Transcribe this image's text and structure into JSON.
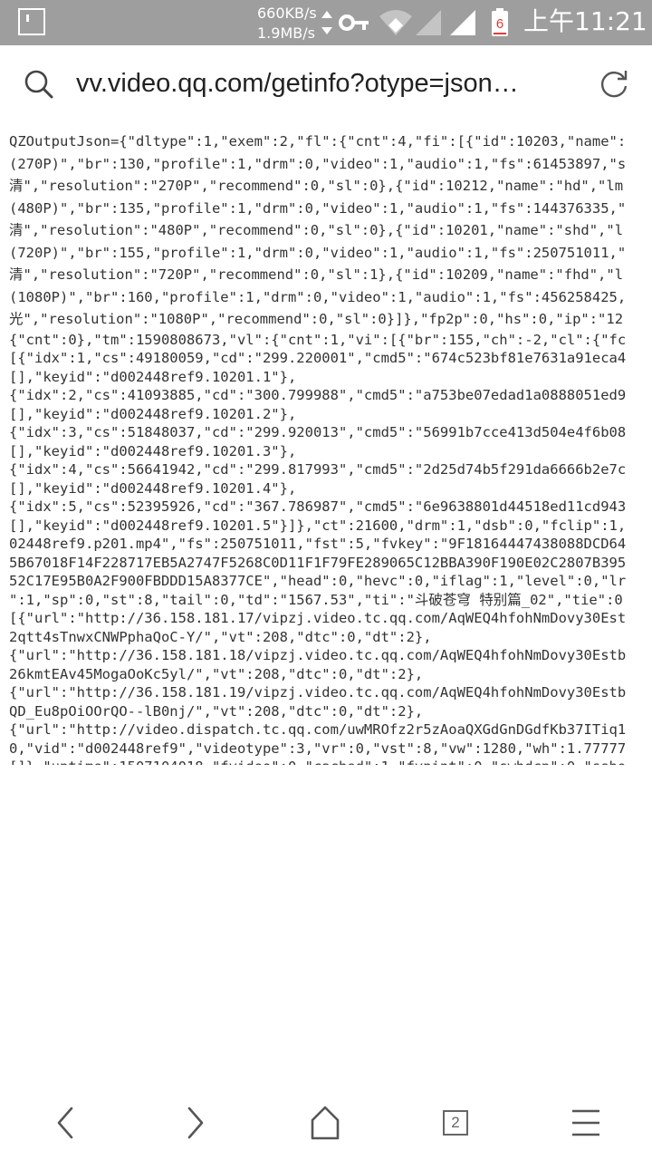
{
  "status_bar": {
    "speed_up": "660KB/s",
    "speed_down": "1.9MB/s",
    "battery_level": "6",
    "time": "上午11:21",
    "icons": [
      "notification-icon",
      "data-arrows-icon",
      "vpn-key-icon",
      "wifi-icon",
      "signal-icon",
      "signal-icon",
      "battery-icon"
    ]
  },
  "browser": {
    "url": "vv.video.qq.com/getinfo?otype=json…",
    "tab_count": "2"
  },
  "content": {
    "lines": [
      "QZOutputJson={\"dltype\":1,\"exem\":2,\"fl\":{\"cnt\":4,\"fi\":[{\"id\":10203,\"name\":",
      "(270P)\",\"br\":130,\"profile\":1,\"drm\":0,\"video\":1,\"audio\":1,\"fs\":61453897,\"s",
      "清\",\"resolution\":\"270P\",\"recommend\":0,\"sl\":0},{\"id\":10212,\"name\":\"hd\",\"lm",
      "(480P)\",\"br\":135,\"profile\":1,\"drm\":0,\"video\":1,\"audio\":1,\"fs\":144376335,\"",
      "清\",\"resolution\":\"480P\",\"recommend\":0,\"sl\":0},{\"id\":10201,\"name\":\"shd\",\"l",
      "(720P)\",\"br\":155,\"profile\":1,\"drm\":0,\"video\":1,\"audio\":1,\"fs\":250751011,\"",
      "清\",\"resolution\":\"720P\",\"recommend\":0,\"sl\":1},{\"id\":10209,\"name\":\"fhd\",\"l",
      "(1080P)\",\"br\":160,\"profile\":1,\"drm\":0,\"video\":1,\"audio\":1,\"fs\":456258425,",
      "光\",\"resolution\":\"1080P\",\"recommend\":0,\"sl\":0}]},\"fp2p\":0,\"hs\":0,\"ip\":\"12",
      "{\"cnt\":0},\"tm\":1590808673,\"vl\":{\"cnt\":1,\"vi\":[{\"br\":155,\"ch\":-2,\"cl\":{\"fc",
      "[{\"idx\":1,\"cs\":49180059,\"cd\":\"299.220001\",\"cmd5\":\"674c523bf81e7631a91eca4",
      "[],\"keyid\":\"d002448ref9.10201.1\"},",
      "{\"idx\":2,\"cs\":41093885,\"cd\":\"300.799988\",\"cmd5\":\"a753be07edad1a0888051ed9",
      "[],\"keyid\":\"d002448ref9.10201.2\"},",
      "{\"idx\":3,\"cs\":51848037,\"cd\":\"299.920013\",\"cmd5\":\"56991b7cce413d504e4f6b08",
      "[],\"keyid\":\"d002448ref9.10201.3\"},",
      "{\"idx\":4,\"cs\":56641942,\"cd\":\"299.817993\",\"cmd5\":\"2d25d74b5f291da6666b2e7c",
      "[],\"keyid\":\"d002448ref9.10201.4\"},",
      "{\"idx\":5,\"cs\":52395926,\"cd\":\"367.786987\",\"cmd5\":\"6e9638801d44518ed11cd943",
      "[],\"keyid\":\"d002448ref9.10201.5\"}]},\"ct\":21600,\"drm\":1,\"dsb\":0,\"fclip\":1,",
      "02448ref9.p201.mp4\",\"fs\":250751011,\"fst\":5,\"fvkey\":\"9F18164447438088DCD64",
      "5B67018F14F228717EB5A2747F5268C0D11F1F79FE289065C12BBA390F190E02C2807B395",
      "52C17E95B0A2F900FBDDD15A8377CE\",\"head\":0,\"hevc\":0,\"iflag\":1,\"level\":0,\"lr",
      "\":1,\"sp\":0,\"st\":8,\"tail\":0,\"td\":\"1567.53\",\"ti\":\"斗破苍穹 特别篇_02\",\"tie\":0",
      "[{\"url\":\"http://36.158.181.17/vipzj.video.tc.qq.com/AqWEQ4hfohNmDovy30Est",
      "2qtt4sTnwxCNWPphaQoC-Y/\",\"vt\":208,\"dtc\":0,\"dt\":2},",
      "{\"url\":\"http://36.158.181.18/vipzj.video.tc.qq.com/AqWEQ4hfohNmDovy30Estb",
      "26kmtEAv45MogaOoKc5yl/\",\"vt\":208,\"dtc\":0,\"dt\":2},",
      "{\"url\":\"http://36.158.181.19/vipzj.video.tc.qq.com/AqWEQ4hfohNmDovy30Estb",
      "QD_Eu8pOiOOrQO--lB0nj/\",\"vt\":208,\"dtc\":0,\"dt\":2},",
      "{\"url\":\"http://video.dispatch.tc.qq.com/uwMROfz2r5zAoaQXGdGnDGdfKb37ITiq1",
      "0,\"vid\":\"d002448ref9\",\"videotype\":3,\"vr\":0,\"vst\":8,\"vw\":1280,\"wh\":1.77777",
      "[]},\"uptime\":1507104018,\"fvideo\":0,\"cached\":1,\"fvpint\":0,\"swhdcp\":0,\"ssho"
    ]
  },
  "nav_icons": [
    "back-icon",
    "forward-icon",
    "home-icon",
    "tabs-icon",
    "menu-icon"
  ]
}
